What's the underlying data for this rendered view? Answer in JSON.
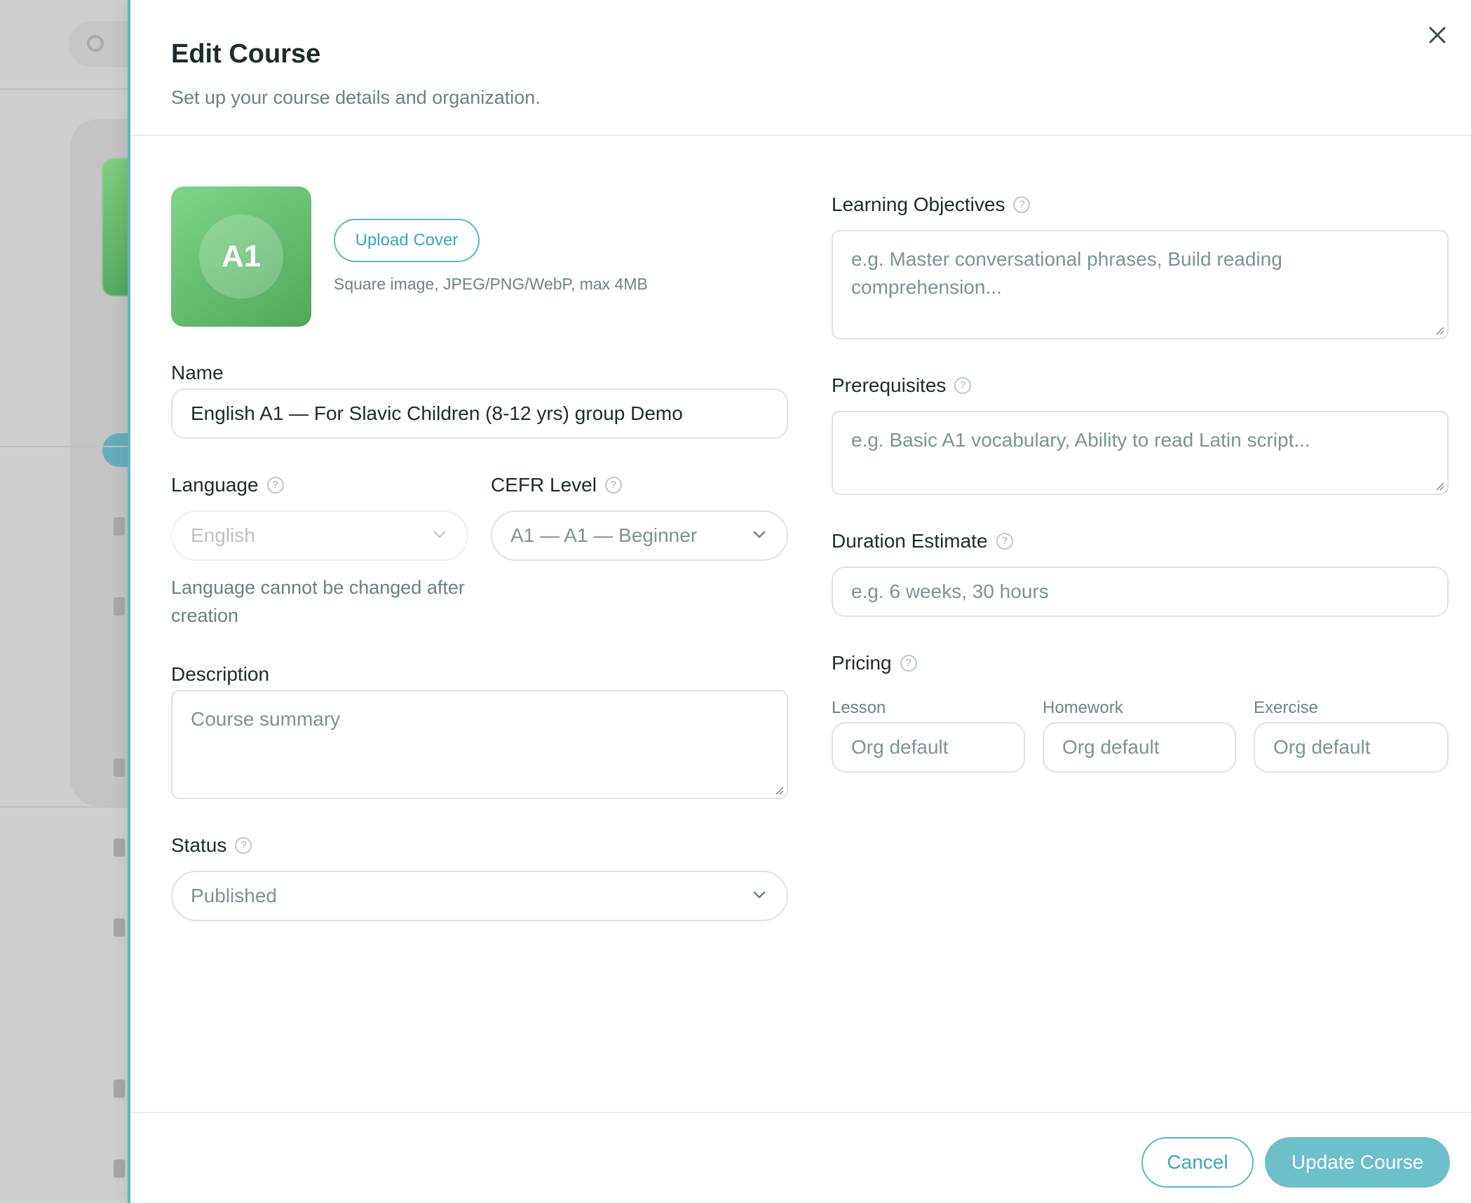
{
  "modal": {
    "title": "Edit Course",
    "subtitle": "Set up your course details and organization."
  },
  "cover": {
    "initials": "A1",
    "upload_label": "Upload Cover",
    "hint": "Square image, JPEG/PNG/WebP, max 4MB"
  },
  "fields": {
    "name_label": "Name",
    "name_value": "English A1 — For Slavic Children (8-12 yrs) group Demo",
    "language_label": "Language",
    "language_value": "English",
    "language_hint": "Language cannot be changed after creation",
    "cefr_label": "CEFR Level",
    "cefr_value": "A1 — A1 — Beginner",
    "description_label": "Description",
    "description_placeholder": "Course summary",
    "status_label": "Status",
    "status_value": "Published",
    "objectives_label": "Learning Objectives",
    "objectives_placeholder": "e.g. Master conversational phrases, Build reading comprehension...",
    "prerequisites_label": "Prerequisites",
    "prerequisites_placeholder": "e.g. Basic A1 vocabulary, Ability to read Latin script...",
    "duration_label": "Duration Estimate",
    "duration_placeholder": "e.g. 6 weeks, 30 hours",
    "pricing_label": "Pricing",
    "pricing": [
      {
        "label": "Lesson",
        "placeholder": "Org default"
      },
      {
        "label": "Homework",
        "placeholder": "Org default"
      },
      {
        "label": "Exercise",
        "placeholder": "Org default"
      }
    ]
  },
  "footer": {
    "cancel_label": "Cancel",
    "submit_label": "Update Course"
  },
  "colors": {
    "accent": "#5fb6c4",
    "primary_button": "#6cc0cc",
    "cover_gradient_start": "#7ed68a",
    "cover_gradient_end": "#4fa85a"
  },
  "icons": {
    "close": "close-icon",
    "help": "help-circle-icon",
    "chevron": "chevron-down-icon"
  }
}
